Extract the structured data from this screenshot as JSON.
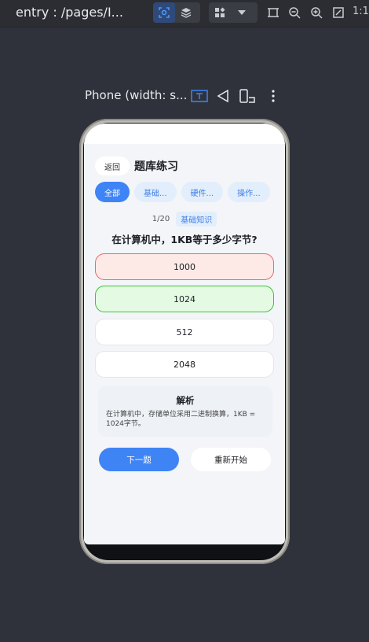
{
  "toolbar": {
    "entry_title": "entry : /pages/I...",
    "zoom_ratio": "1:1",
    "icons": [
      "inspect-icon",
      "layers-icon",
      "components-icon",
      "chevron-down-icon",
      "frame-icon",
      "zoom-out-icon",
      "zoom-in-icon",
      "fit-icon"
    ]
  },
  "device": {
    "label": "Phone (width: s...",
    "icons": [
      "text-icon",
      "rotate-icon",
      "device-switch-icon",
      "more-icon"
    ]
  },
  "app": {
    "back_label": "返回",
    "title": "题库练习",
    "tabs": [
      {
        "label": "全部",
        "active": true
      },
      {
        "label": "基础...",
        "active": false
      },
      {
        "label": "硬件...",
        "active": false
      },
      {
        "label": "操作...",
        "active": false
      }
    ],
    "progress": "1/20",
    "category": "基础知识",
    "question": "在计算机中，1KB等于多少字节?",
    "options": [
      {
        "label": "1000",
        "state": "wrong"
      },
      {
        "label": "1024",
        "state": "correct"
      },
      {
        "label": "512",
        "state": "normal"
      },
      {
        "label": "2048",
        "state": "normal"
      }
    ],
    "explanation_title": "解析",
    "explanation_text": "在计算机中，存储单位采用二进制换算，1KB = 1024字节。",
    "next_label": "下一题",
    "restart_label": "重新开始"
  },
  "colors": {
    "accent": "#3f84f5",
    "wrong_border": "#e56b6b",
    "correct_border": "#44c23a"
  }
}
